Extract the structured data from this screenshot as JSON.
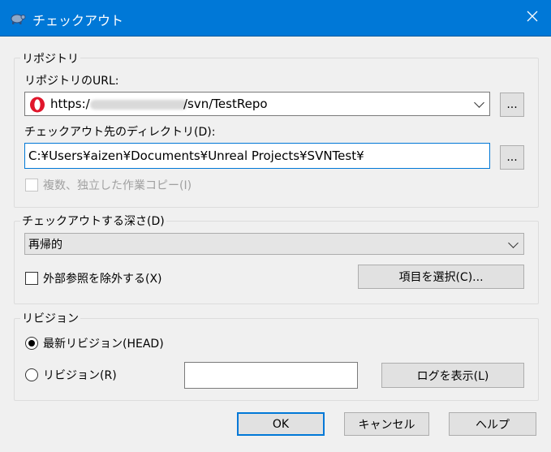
{
  "window": {
    "title": "チェックアウト",
    "close_icon": "close-icon"
  },
  "repository": {
    "group_label": "リポジトリ",
    "url_label": "リポジトリのURL:",
    "url_value": "https://           /svn/TestRepo",
    "url_value_prefix": "https:/",
    "url_value_suffix": "/svn/TestRepo",
    "browse_label": "...",
    "dir_label": "チェックアウト先のディレクトリ(D):",
    "dir_value": "C:¥Users¥aizen¥Documents¥Unreal Projects¥SVNTest¥",
    "dir_browse_label": "...",
    "multi_copy_label": "複数、独立した作業コピー(I)"
  },
  "depth": {
    "group_label": "チェックアウトする深さ(D)",
    "selected": "再帰的",
    "exclude_externals_label": "外部参照を除外する(X)",
    "choose_items_label": "項目を選択(C)..."
  },
  "revision": {
    "group_label": "リビジョン",
    "head_label": "最新リビジョン(HEAD)",
    "revision_label": "リビジョン(R)",
    "revision_value": "",
    "show_log_label": "ログを表示(L)"
  },
  "buttons": {
    "ok": "OK",
    "cancel": "キャンセル",
    "help": "ヘルプ"
  },
  "colors": {
    "accent": "#0078d7",
    "opera_red": "#e0162b"
  }
}
